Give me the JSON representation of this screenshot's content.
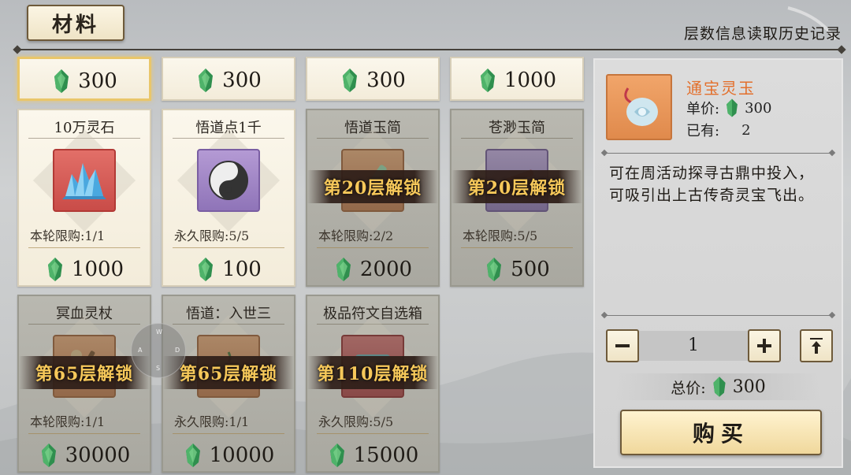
{
  "header": {
    "tab_label": "材料",
    "history_link": "层数信息读取历史记录"
  },
  "colors": {
    "accent_unlock": "#f6c85a",
    "item_name_highlight": "#e36f2b",
    "gem": "#2f8f4e"
  },
  "top_row": [
    {
      "price": "300",
      "selected": true
    },
    {
      "price": "300"
    },
    {
      "price": "300"
    },
    {
      "price": "1000"
    }
  ],
  "items": [
    {
      "name": "10万灵石",
      "icon": "spirit-stone-cluster-icon",
      "limit": "本轮限购:1/1",
      "price": "1000"
    },
    {
      "name": "悟道点1千",
      "icon": "yin-yang-icon",
      "limit": "永久限购:5/5",
      "price": "100"
    },
    {
      "name": "悟道玉简",
      "icon": "jade-slip-icon",
      "limit": "本轮限购:2/2",
      "price": "2000",
      "unlock": "第20层解锁"
    },
    {
      "name": "苍渺玉简",
      "icon": "bamboo-scroll-icon",
      "limit": "本轮限购:5/5",
      "price": "500",
      "unlock": "第20层解锁"
    },
    {
      "name": "冥血灵杖",
      "icon": "staff-icon",
      "limit": "本轮限购:1/1",
      "price": "30000",
      "unlock": "第65层解锁"
    },
    {
      "name": "悟道：入世三",
      "icon": "fruit-icon",
      "limit": "永久限购:1/1",
      "price": "10000",
      "unlock": "第65层解锁"
    },
    {
      "name": "极品符文自选箱",
      "icon": "treasure-chest-icon",
      "limit": "永久限购:5/5",
      "price": "15000",
      "unlock": "第110层解锁"
    }
  ],
  "detail": {
    "name": "通宝灵玉",
    "icon": "jade-pendant-icon",
    "unit_price_label": "单价:",
    "unit_price": "300",
    "owned_label": "已有:",
    "owned": "2",
    "description": "可在周活动探寻古鼎中投入，可吸引出上古传奇灵宝飞出。",
    "quantity": "1",
    "total_label": "总价:",
    "total": "300",
    "buy_label": "购买"
  },
  "joystick": {
    "keys": [
      "W",
      "A",
      "S",
      "D"
    ]
  }
}
